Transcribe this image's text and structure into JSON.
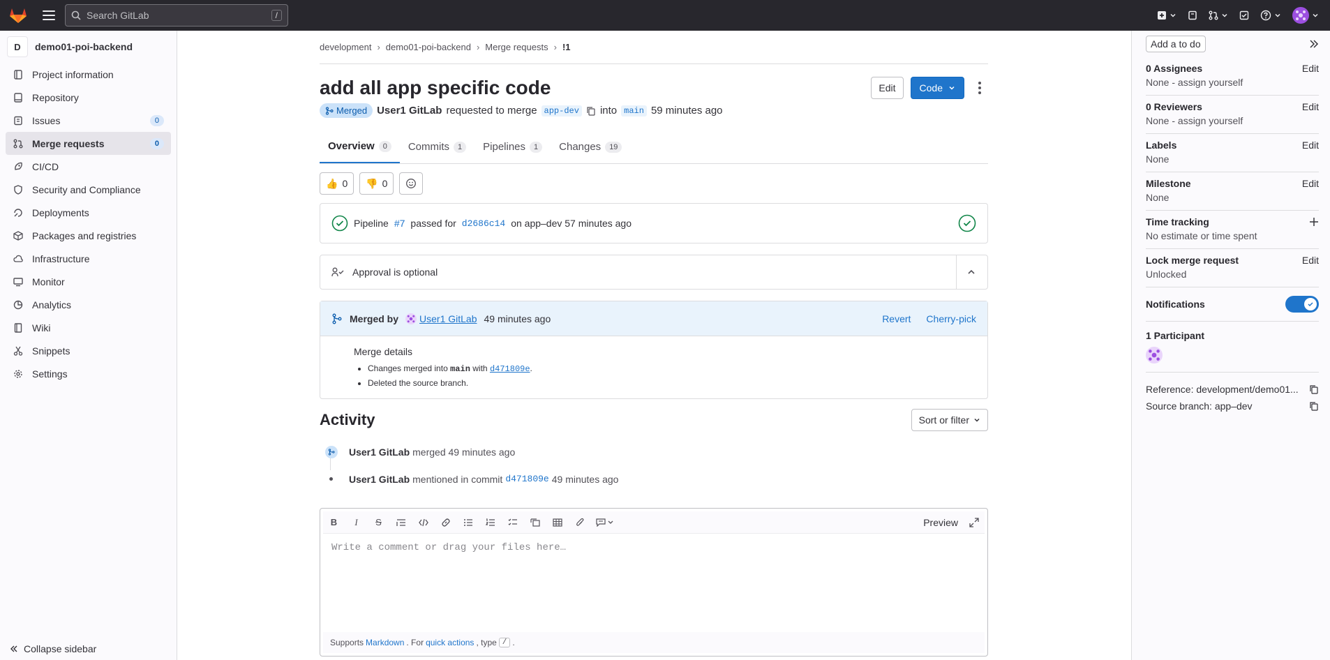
{
  "topbar": {
    "search_placeholder": "Search GitLab",
    "search_shortcut": "/"
  },
  "sidebar": {
    "project_initial": "D",
    "project_name": "demo01-poi-backend",
    "items": [
      {
        "label": "Project information",
        "icon": "info-icon"
      },
      {
        "label": "Repository",
        "icon": "repository-icon"
      },
      {
        "label": "Issues",
        "icon": "issues-icon",
        "count": "0"
      },
      {
        "label": "Merge requests",
        "icon": "merge-request-icon",
        "count": "0",
        "active": true
      },
      {
        "label": "CI/CD",
        "icon": "rocket-icon"
      },
      {
        "label": "Security and Compliance",
        "icon": "shield-icon"
      },
      {
        "label": "Deployments",
        "icon": "deployments-icon"
      },
      {
        "label": "Packages and registries",
        "icon": "package-icon"
      },
      {
        "label": "Infrastructure",
        "icon": "cloud-icon"
      },
      {
        "label": "Monitor",
        "icon": "monitor-icon"
      },
      {
        "label": "Analytics",
        "icon": "chart-icon"
      },
      {
        "label": "Wiki",
        "icon": "book-icon"
      },
      {
        "label": "Snippets",
        "icon": "snippet-icon"
      },
      {
        "label": "Settings",
        "icon": "gear-icon"
      }
    ],
    "collapse_label": "Collapse sidebar"
  },
  "breadcrumb": [
    "development",
    "demo01-poi-backend",
    "Merge requests",
    "!1"
  ],
  "mr": {
    "title": "add all app specific code",
    "edit_label": "Edit",
    "code_label": "Code",
    "status": "Merged",
    "author": "User1 GitLab",
    "requested_text": "requested to merge",
    "source_branch": "app-dev",
    "into_text": "into",
    "target_branch": "main",
    "time_ago": "59 minutes ago"
  },
  "tabs": [
    {
      "label": "Overview",
      "count": "0"
    },
    {
      "label": "Commits",
      "count": "1"
    },
    {
      "label": "Pipelines",
      "count": "1"
    },
    {
      "label": "Changes",
      "count": "19"
    }
  ],
  "reactions": {
    "thumbs_up": "0",
    "thumbs_down": "0"
  },
  "pipeline": {
    "prefix": "Pipeline",
    "id": "#7",
    "passed_text": "passed for",
    "commit": "d2686c14",
    "on_text": "on app–dev 57 minutes ago"
  },
  "approval": {
    "text": "Approval is optional"
  },
  "merge_widget": {
    "merged_by": "Merged by",
    "user": "User1 GitLab",
    "time": "49 minutes ago",
    "revert": "Revert",
    "cherry_pick": "Cherry-pick",
    "details_title": "Merge details",
    "detail1_prefix": "Changes merged into",
    "detail1_branch": "main",
    "detail1_with": "with",
    "detail1_commit": "d471809e",
    "detail2": "Deleted the source branch."
  },
  "activity": {
    "title": "Activity",
    "sort_label": "Sort or filter",
    "items": [
      {
        "user": "User1 GitLab",
        "text": "merged 49 minutes ago"
      },
      {
        "user": "User1 GitLab",
        "text": "mentioned in commit",
        "commit": "d471809e",
        "time": "49 minutes ago"
      }
    ]
  },
  "editor": {
    "preview": "Preview",
    "placeholder": "Write a comment or drag your files here…",
    "footer_supports": "Supports",
    "footer_markdown": "Markdown",
    "footer_for": ". For",
    "footer_quick": "quick actions",
    "footer_type": ", type",
    "footer_slash": "/",
    "footer_end": "."
  },
  "right_sidebar": {
    "todo": "Add a to do",
    "assignees_title": "0 Assignees",
    "assignees_value": "None - assign yourself",
    "reviewers_title": "0 Reviewers",
    "reviewers_value": "None - assign yourself",
    "labels_title": "Labels",
    "labels_value": "None",
    "milestone_title": "Milestone",
    "milestone_value": "None",
    "time_title": "Time tracking",
    "time_value": "No estimate or time spent",
    "lock_title": "Lock merge request",
    "lock_value": "Unlocked",
    "notifications_title": "Notifications",
    "notifications_on": true,
    "participants_title": "1 Participant",
    "reference": "Reference: development/demo01...",
    "source_branch": "Source branch: app–dev",
    "edit": "Edit"
  },
  "colors": {
    "accent": "#1f75cb",
    "topbar": "#28272d",
    "success": "#108548"
  }
}
